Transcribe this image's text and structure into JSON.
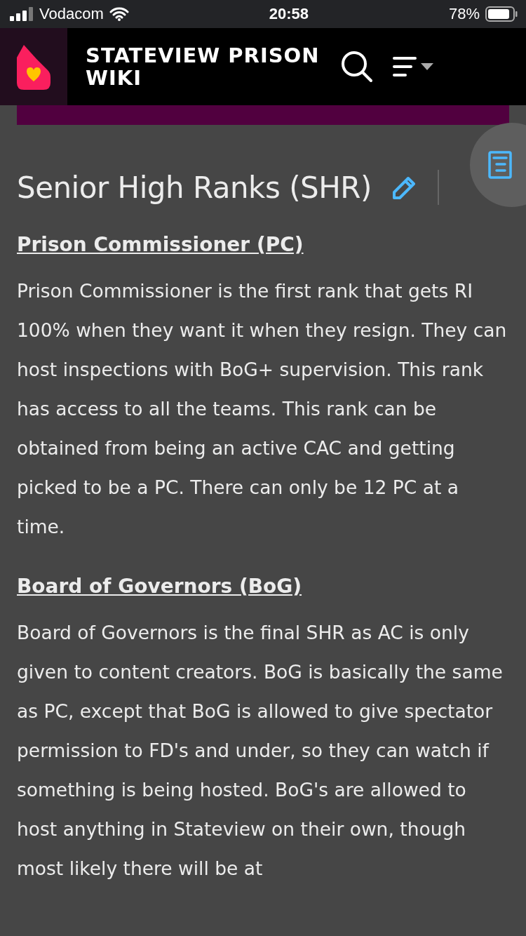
{
  "status_bar": {
    "carrier": "Vodacom",
    "time": "20:58",
    "battery": "78%"
  },
  "header": {
    "title": "STATEVIEW PRISON WIKI"
  },
  "article": {
    "heading": "Senior High Ranks (SHR)",
    "sections": [
      {
        "title": "Prison Commissioner (PC)",
        "text": "Prison Commissioner is the first rank that gets RI 100% when they want it when they resign. They can host inspections with BoG+ supervision. This rank has access to all the teams. This rank can be obtained from being an active CAC and getting picked to be a PC. There can only be 12 PC at a time."
      },
      {
        "title": "Board of Governors (BoG)",
        "text": "Board of Governors is the final SHR as AC is only given to content creators. BoG is basically the same as PC, except that BoG is allowed to give spectator permission to FD's and under, so they can watch if something is being hosted. BoG's are allowed to host anything in Stateview on their own, though most likely there will be at"
      }
    ]
  }
}
